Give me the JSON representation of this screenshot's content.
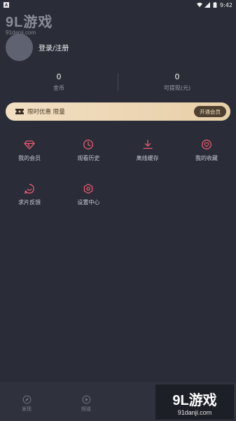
{
  "status_bar": {
    "time": "9:42",
    "left_icon": "a-notification-icon",
    "wifi_icon": "wifi-icon",
    "signal_icon": "signal-icon",
    "battery_icon": "battery-icon"
  },
  "watermark_top": {
    "main": "9L游戏",
    "sub": "91danji.com"
  },
  "profile": {
    "login_label": "登录/注册"
  },
  "stats": [
    {
      "value": "0",
      "label": "金币"
    },
    {
      "value": "0",
      "label": "可提现(元)"
    }
  ],
  "vip_banner": {
    "text": "限时优惠 限量",
    "button_label": "开通会员",
    "icon": "ticket-icon"
  },
  "menu": [
    {
      "label": "我的会员",
      "icon": "diamond-icon"
    },
    {
      "label": "观看历史",
      "icon": "clock-icon"
    },
    {
      "label": "离线缓存",
      "icon": "download-icon"
    },
    {
      "label": "我的收藏",
      "icon": "heart-icon"
    },
    {
      "label": "求片反馈",
      "icon": "smile-icon"
    },
    {
      "label": "设置中心",
      "icon": "settings-icon"
    }
  ],
  "bottom_nav": [
    {
      "label": "发现",
      "icon": "compass-icon"
    },
    {
      "label": "频道",
      "icon": "play-icon"
    }
  ],
  "watermark_bottom": {
    "main": "9L游戏",
    "sub": "91danji.com"
  },
  "colors": {
    "accent": "#e85a6e",
    "background": "#2a2d38",
    "banner": "#f2dfc2"
  }
}
